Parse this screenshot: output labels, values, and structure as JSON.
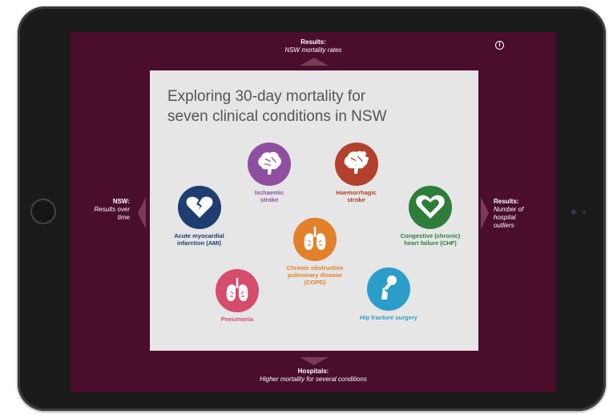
{
  "nav": {
    "top": {
      "title": "Results:",
      "subtitle": "NSW mortality rates"
    },
    "bottom": {
      "title": "Hospitals:",
      "subtitle": "Higher mortality for several conditions"
    },
    "left": {
      "title": "NSW:",
      "subtitle_line1": "Results over",
      "subtitle_line2": "time"
    },
    "right": {
      "title": "Results:",
      "subtitle_line1": "Number of",
      "subtitle_line2": "hospital",
      "subtitle_line3": "outliers"
    }
  },
  "info_glyph": "i",
  "panel": {
    "title_line1": "Exploring 30-day mortality for",
    "title_line2": "seven clinical conditions in NSW"
  },
  "conditions": [
    {
      "id": "ami",
      "line1": "Acute myocardial",
      "line2": "infarction (AMI)",
      "line3": "",
      "color": "#1d3e6e",
      "icon": "broken-heart-icon"
    },
    {
      "id": "ischaemic",
      "line1": "Ischaemic",
      "line2": "stroke",
      "line3": "",
      "color": "#8e4fa0",
      "icon": "brain-icon"
    },
    {
      "id": "haemorrhagic",
      "line1": "Haemorrhagic",
      "line2": "stroke",
      "line3": "",
      "color": "#b3402c",
      "icon": "brain-bleed-icon"
    },
    {
      "id": "chf",
      "line1": "Congestive (chronic)",
      "line2": "heart failure (CHF)",
      "line3": "",
      "color": "#2e7d3a",
      "icon": "heart-icon"
    },
    {
      "id": "copd",
      "line1": "Chronic obstructive",
      "line2": "pulmonary disease",
      "line3": "(COPD)",
      "color": "#e2812a",
      "icon": "lungs-icon"
    },
    {
      "id": "pneumonia",
      "line1": "Pneumonia",
      "line2": "",
      "line3": "",
      "color": "#d64d6b",
      "icon": "lungs-icon"
    },
    {
      "id": "hip",
      "line1": "Hip fracture surgery",
      "line2": "",
      "line3": "",
      "color": "#2a9ec9",
      "icon": "bone-icon"
    }
  ]
}
